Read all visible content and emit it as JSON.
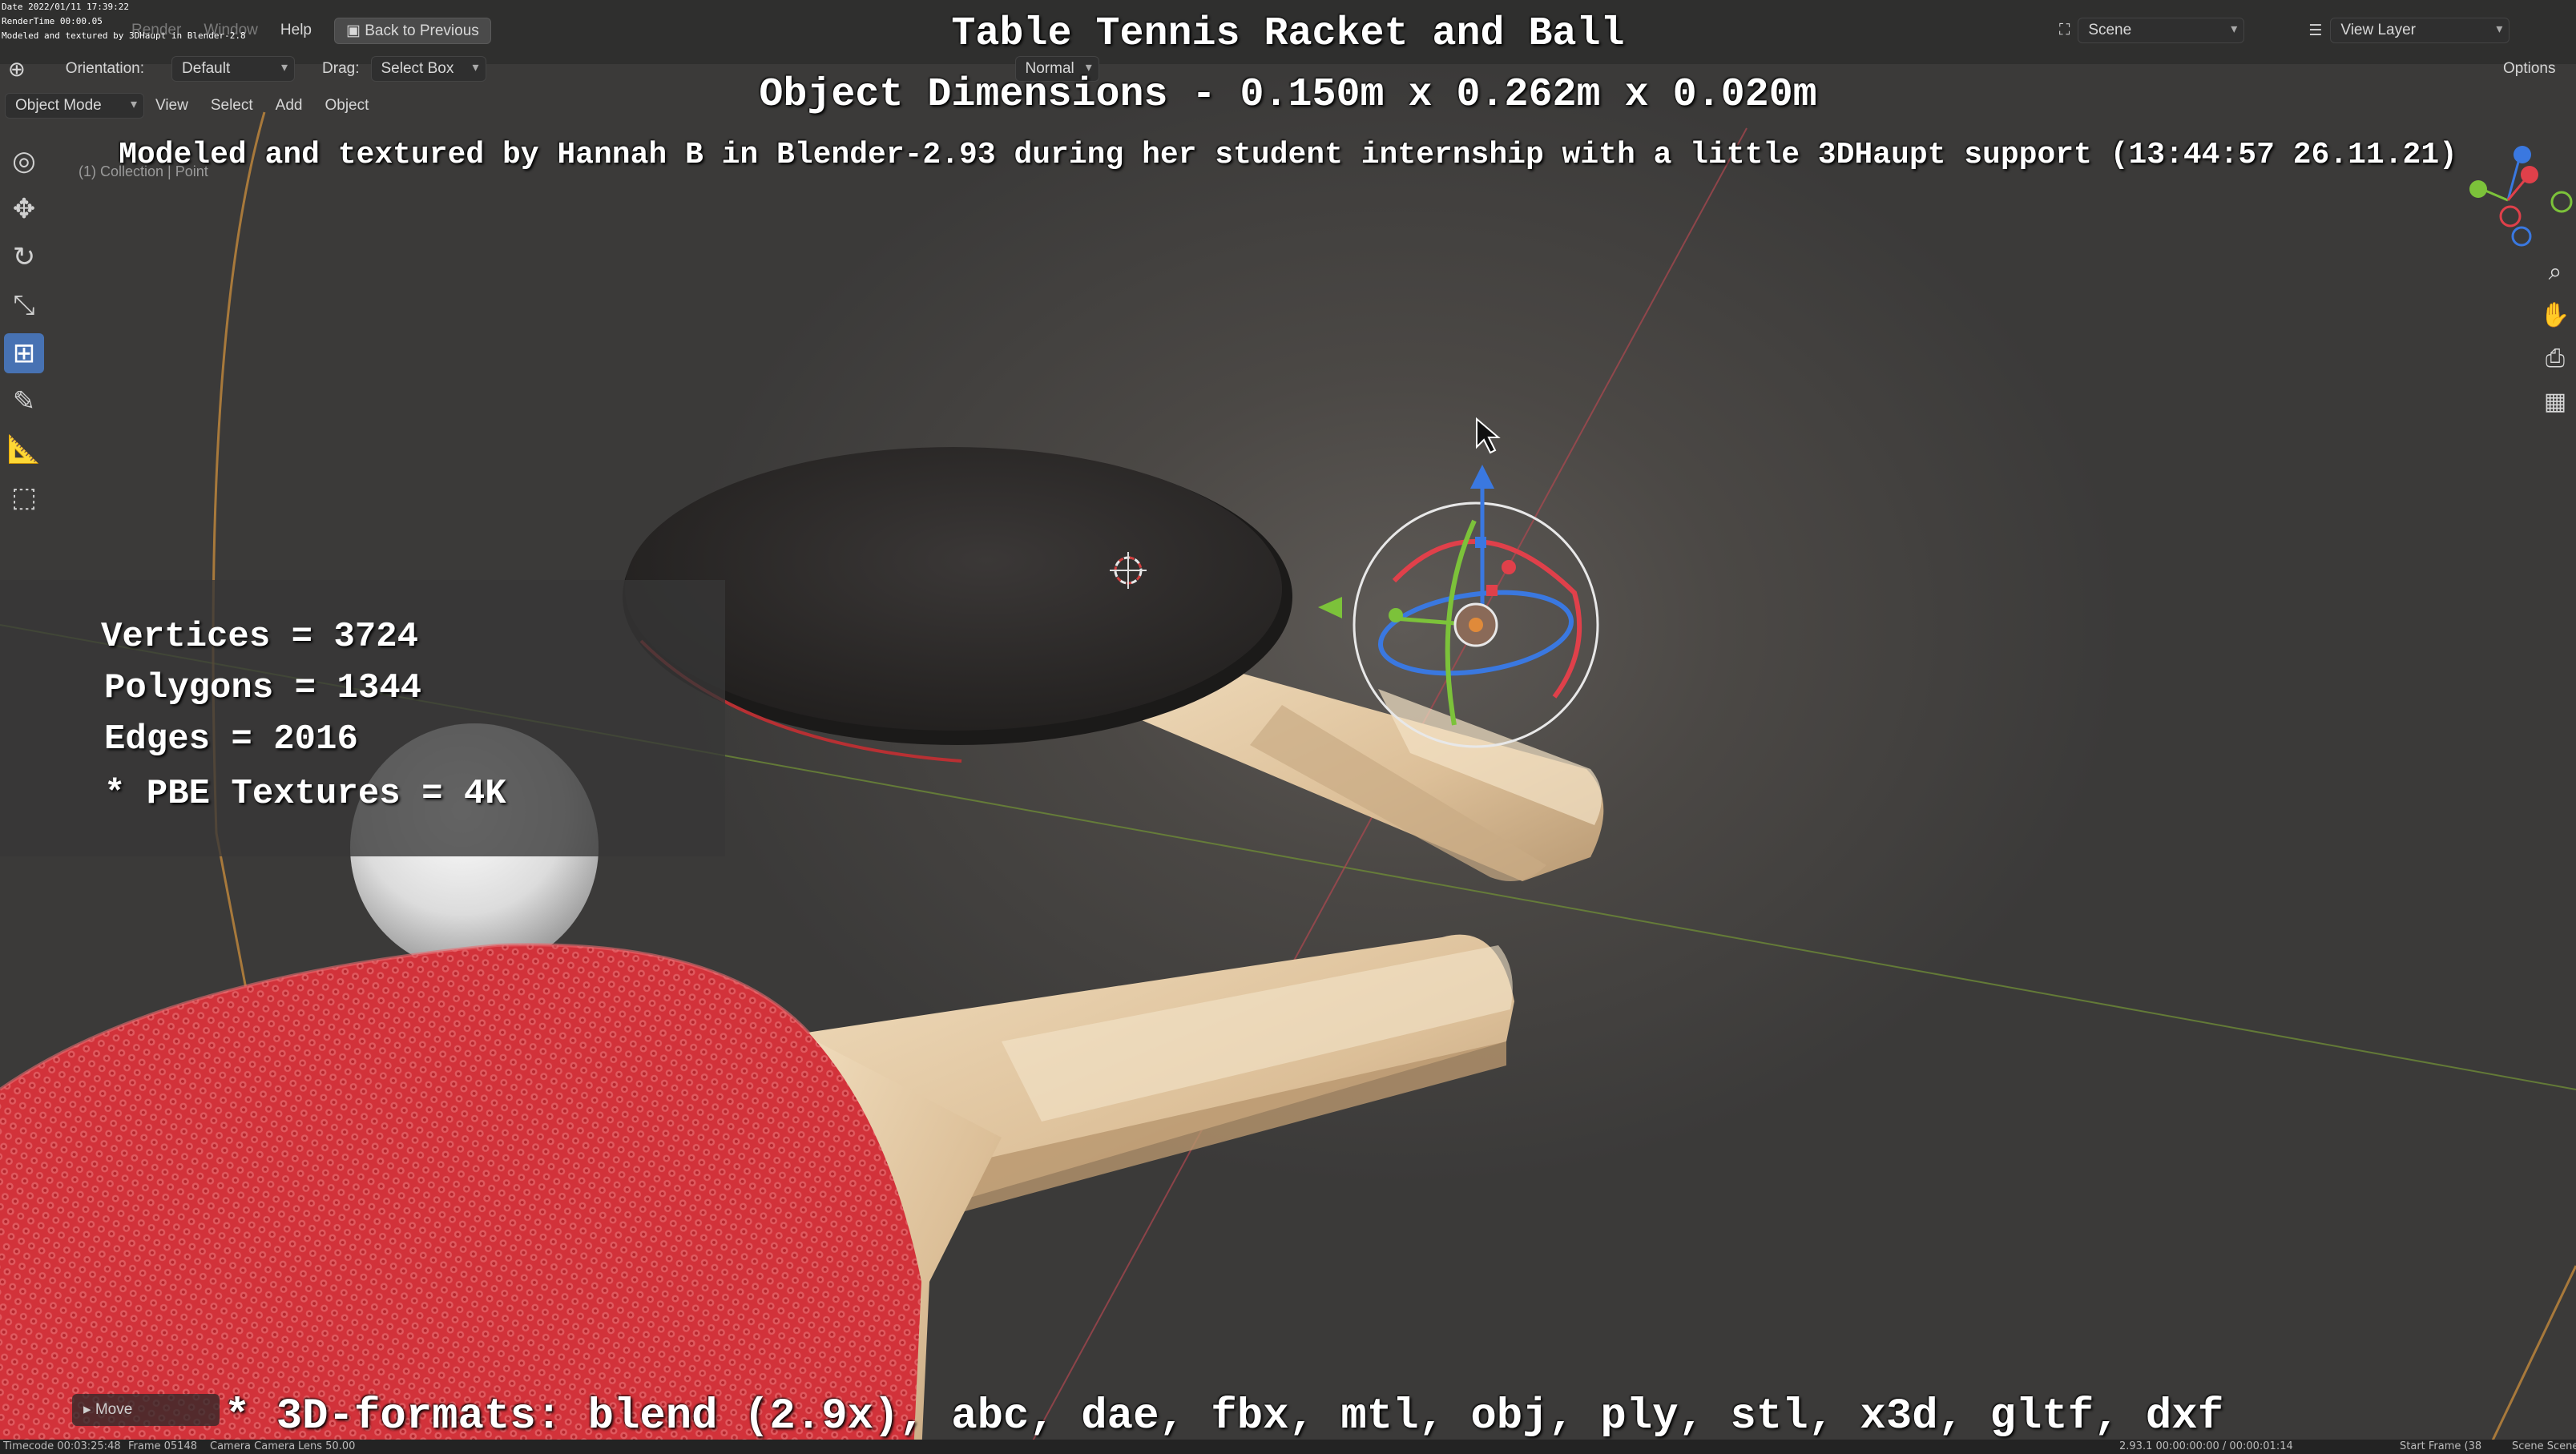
{
  "top_info": {
    "date": "Date 2022/01/11 17:39:22",
    "render_time": "RenderTime 00:00.05",
    "credit_small": "Modeled and textured by 3DHaupt in Blender-2.8"
  },
  "menu": {
    "items": [
      "Render",
      "Window",
      "Help"
    ],
    "back_button": "Back to Previous"
  },
  "header": {
    "scene_label": "Scene",
    "view_layer_label": "View Layer",
    "options_label": "Options"
  },
  "toolbar": {
    "orientation_label": "Orientation:",
    "orientation_value": "Default",
    "drag_label": "Drag:",
    "drag_value": "Select Box",
    "pivot_value": "Normal"
  },
  "mode_bar": {
    "mode": "Object Mode",
    "menus": [
      "View",
      "Select",
      "Add",
      "Object"
    ]
  },
  "viewport_info": {
    "collection": "(1) Collection | Point"
  },
  "overlay": {
    "title": "Table Tennis Racket and Ball",
    "dimensions": "Object Dimensions -  0.150m x 0.262m x 0.020m",
    "credit": "Modeled and textured by Hannah B in Blender-2.93 during her student internship with a little 3DHaupt support (13:44:57 26.11.21)",
    "formats": "* 3D-formats: blend (2.9x), abc, dae, fbx, mtl, obj, ply, stl, x3d, gltf, dxf"
  },
  "stats": {
    "vertices": "Vertices = 3724",
    "polygons": "Polygons = 1344",
    "edges": "Edges = 2016",
    "textures": "* PBE Textures = 4K"
  },
  "operator_panel": {
    "label": "Move"
  },
  "status_bar": {
    "timecode": "Timecode 00:03:25:48",
    "frame": "Frame 05148",
    "camera": "Camera Camera",
    "lens": "Lens 50.00",
    "version_time": "2.93.1  00:00:00:00 / 00:00:01:14",
    "start_frame": "Start Frame (38",
    "scene": "Scene Scene"
  },
  "colors": {
    "rubber_red": "#d2323a",
    "rubber_black": "#2b2928",
    "wood": "#e3c9a3",
    "gizmo_x": "#e0404a",
    "gizmo_y": "#7cc23a",
    "gizmo_z": "#3a78e0",
    "active_tool": "#4772b3"
  },
  "icons": [
    "cursor-icon",
    "move-icon",
    "rotate-icon",
    "scale-icon",
    "transform-icon",
    "annotate-icon",
    "measure-icon",
    "add-cube-icon",
    "zoom-icon",
    "hand-icon",
    "camera-icon",
    "grid-icon"
  ]
}
